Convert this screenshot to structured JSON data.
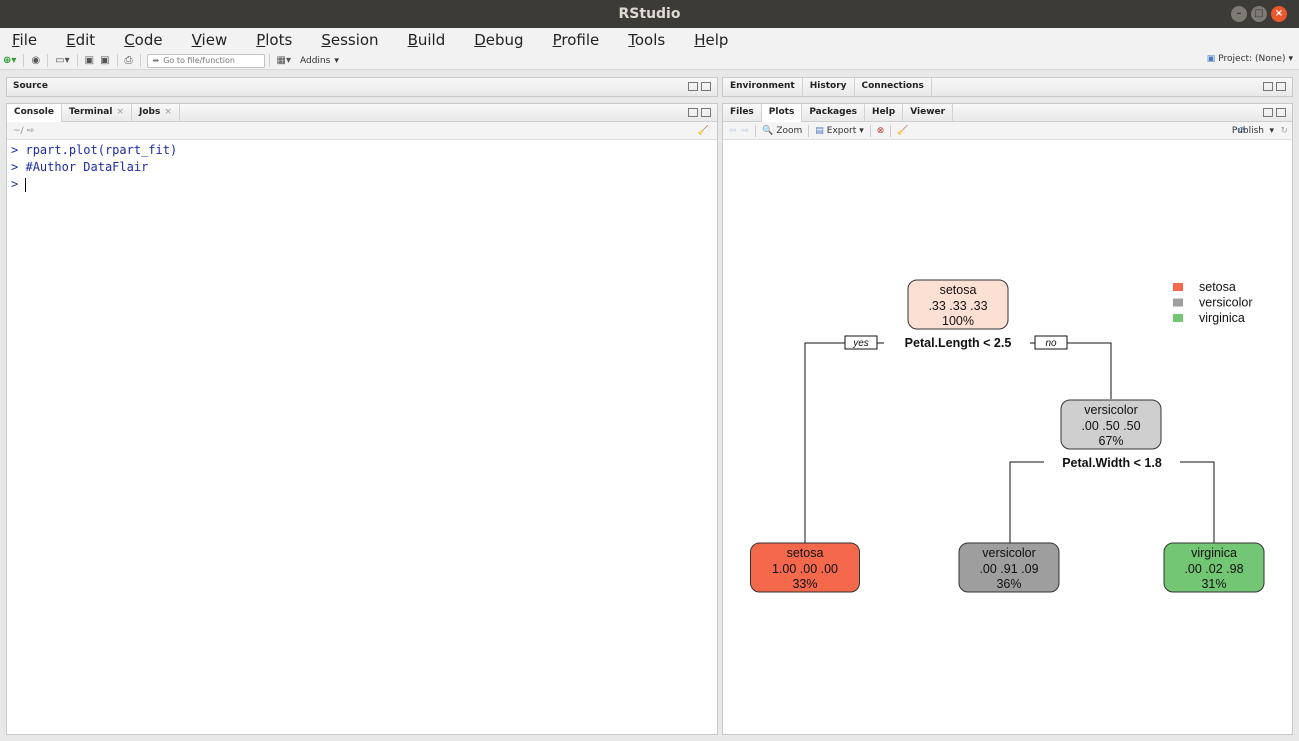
{
  "window": {
    "title": "RStudio"
  },
  "menu": [
    "File",
    "Edit",
    "Code",
    "View",
    "Plots",
    "Session",
    "Build",
    "Debug",
    "Profile",
    "Tools",
    "Help"
  ],
  "toolbar": {
    "goto_placeholder": "Go to file/function",
    "addins": "Addins",
    "project": "Project: (None)"
  },
  "source_pane": {
    "title": "Source"
  },
  "console_pane": {
    "tabs": [
      "Console",
      "Terminal",
      "Jobs"
    ],
    "path": "~/",
    "lines": [
      "rpart.plot(rpart_fit)",
      "#Author DataFlair",
      ""
    ],
    "prompt": ">"
  },
  "env_pane": {
    "tabs": [
      "Environment",
      "History",
      "Connections"
    ]
  },
  "files_pane": {
    "tabs": [
      "Files",
      "Plots",
      "Packages",
      "Help",
      "Viewer"
    ],
    "zoom": "Zoom",
    "export": "Export",
    "publish": "Publish"
  },
  "chart_data": {
    "type": "tree",
    "legend": [
      {
        "name": "setosa",
        "color": "#f4684c"
      },
      {
        "name": "versicolor",
        "color": "#9e9e9e"
      },
      {
        "name": "virginica",
        "color": "#73c674"
      }
    ],
    "root": {
      "class": "setosa",
      "probs": ".33  .33  .33",
      "pct": "100%",
      "split": "Petal.Length < 2.5",
      "fill": "#fde0d4"
    },
    "node2": {
      "class": "versicolor",
      "probs": ".00  .50  .50",
      "pct": "67%",
      "split": "Petal.Width < 1.8",
      "fill": "#cfcfcf"
    },
    "leaves": [
      {
        "class": "setosa",
        "probs": "1.00  .00  .00",
        "pct": "33%",
        "fill": "#f4684c"
      },
      {
        "class": "versicolor",
        "probs": ".00  .91  .09",
        "pct": "36%",
        "fill": "#9e9e9e"
      },
      {
        "class": "virginica",
        "probs": ".00  .02  .98",
        "pct": "31%",
        "fill": "#73c674"
      }
    ],
    "edge_labels": [
      "yes",
      "no"
    ]
  }
}
